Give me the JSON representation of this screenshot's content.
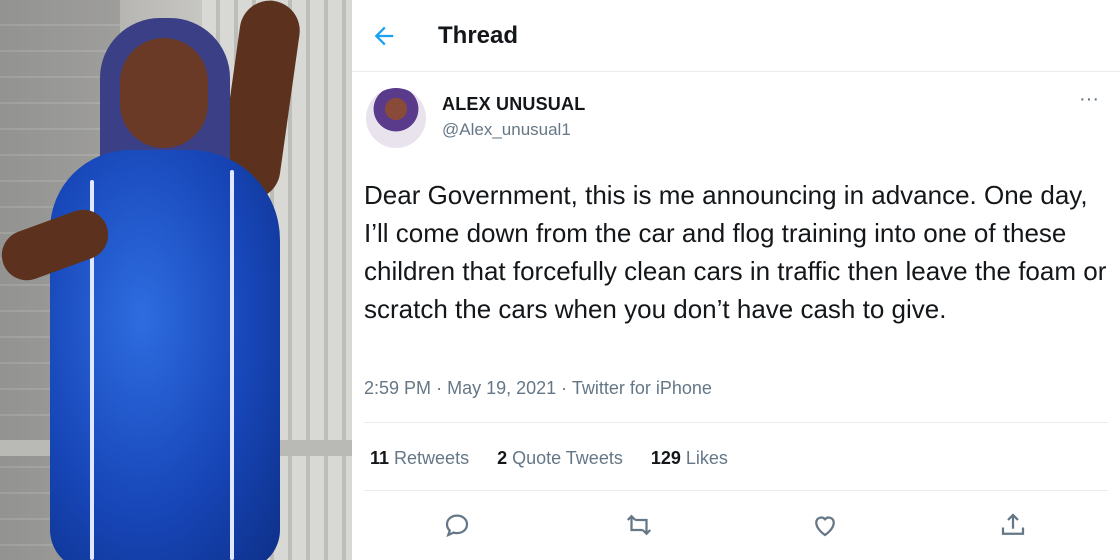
{
  "header": {
    "title": "Thread",
    "back_icon": "arrow-left-icon"
  },
  "user": {
    "name": "ALEX UNUSUAL",
    "handle": "@Alex_unusual1"
  },
  "tweet": {
    "text": "Dear Government, this is me announcing in advance. One day, I’ll come down from the car and flog training into one of these children that forcefully clean cars in traffic then leave the foam or scratch the cars when you don’t have cash to give.",
    "time": "2:59 PM",
    "date": "May 19, 2021",
    "source": "Twitter for iPhone",
    "separator": "·"
  },
  "stats": {
    "retweets_count": "11",
    "retweets_label": "Retweets",
    "quotes_count": "2",
    "quotes_label": "Quote Tweets",
    "likes_count": "129",
    "likes_label": "Likes"
  },
  "actions": [
    "reply-icon",
    "retweet-icon",
    "like-icon",
    "share-icon"
  ],
  "colors": {
    "accent": "#1da1f2",
    "text": "#14171a",
    "muted": "#657786",
    "divider": "#e6ecf0"
  }
}
